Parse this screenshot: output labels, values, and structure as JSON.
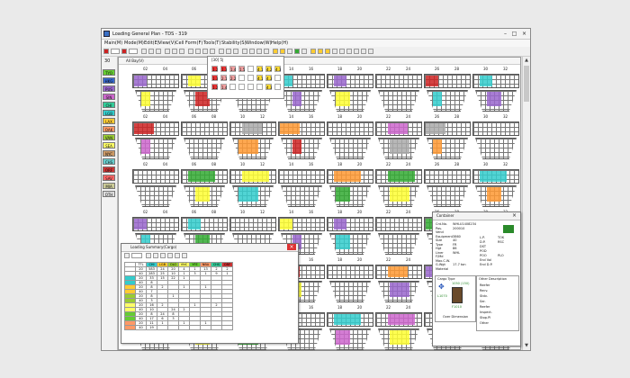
{
  "window": {
    "title": "Loading General Plan - TDS - 319"
  },
  "menu": [
    "Main(M)",
    "Mode(M)",
    "Edit(E)",
    "View(V)",
    "Cell Form(F)",
    "Tools(T)",
    "Stability(S)",
    "Window(W)",
    "Help(H)"
  ],
  "left_panel": {
    "counter": "30",
    "chips": [
      {
        "label": "TYO",
        "color": "#66cc33"
      },
      {
        "label": "HKG",
        "color": "#3366cc"
      },
      {
        "label": "PUS",
        "color": "#9966cc"
      },
      {
        "label": "SIN",
        "color": "#cc66cc"
      },
      {
        "label": "CHI",
        "color": "#33cc99"
      },
      {
        "label": "LGB",
        "color": "#33cccc"
      },
      {
        "label": "LAX",
        "color": "#ffcc33"
      },
      {
        "label": "OAK",
        "color": "#ff9966"
      },
      {
        "label": "VAN",
        "color": "#99cc33"
      },
      {
        "label": "SEA",
        "color": "#ffff66"
      },
      {
        "label": "NYC",
        "color": "#cc9966"
      },
      {
        "label": "CHS",
        "color": "#66cccc"
      },
      {
        "label": "ORF",
        "color": "#cc3333"
      },
      {
        "label": "SAV",
        "color": "#ff6666"
      },
      {
        "label": "MIA",
        "color": "#cccc99"
      },
      {
        "label": "OTH",
        "color": "#dddddd"
      }
    ]
  },
  "main_window": {
    "title": "All Bay(V)"
  },
  "popup": {
    "title": "[30] 5|",
    "cells": [
      "1.2",
      "1.3",
      "1.4",
      "1.5",
      "",
      "4.1",
      "4.2",
      "4.3",
      "1.3",
      "2.1",
      "2.2",
      "",
      "",
      "4.1",
      "4.3",
      "",
      "1.2",
      "1.4",
      "",
      "",
      "",
      "",
      "4.3",
      ""
    ]
  },
  "bays": [
    {
      "top": "02",
      "bot": "04"
    },
    {
      "top": "06",
      "bot": "08"
    },
    {
      "top": "10",
      "bot": "12"
    },
    {
      "top": "14",
      "bot": "16"
    },
    {
      "top": "18",
      "bot": "20"
    },
    {
      "top": "22",
      "bot": "24"
    },
    {
      "top": "26",
      "bot": "28"
    },
    {
      "top": "30",
      "bot": "32"
    }
  ],
  "row_labels": [
    "01",
    "03",
    "05",
    "07",
    "09",
    "11",
    "13",
    "15"
  ],
  "loading_summary": {
    "title": "Loading Summary(Cargo)",
    "headers": [
      "",
      "TTL",
      "CHI",
      "LGB",
      "OLO",
      "VNC",
      "YFE",
      "NBA",
      "CHS",
      "ORF"
    ],
    "header_colors": [
      "#ffffff",
      "#ffffff",
      "#33cccc",
      "#ffcc33",
      "#99cc33",
      "#ffff66",
      "#66cc33",
      "#ff9966",
      "#33cc99",
      "#cc3333"
    ],
    "rows": [
      [
        "20",
        "583",
        "24",
        "20",
        "4",
        "1",
        "13",
        "2",
        "2"
      ],
      [
        "40",
        "283",
        "25",
        "10",
        "1",
        "3",
        "1",
        "9",
        "1"
      ],
      [
        "20",
        "33",
        "15",
        "22",
        "1",
        "",
        "",
        "",
        ""
      ],
      [
        "40",
        "8",
        "",
        "",
        "",
        "",
        "",
        "",
        ""
      ],
      [
        "20",
        "8",
        "2",
        "",
        "1",
        "",
        "1",
        "",
        ""
      ],
      [
        "40",
        "7",
        "",
        "",
        "",
        "",
        "",
        "",
        ""
      ],
      [
        "20",
        "8",
        "",
        "1",
        "",
        "",
        "",
        "",
        ""
      ],
      [
        "40",
        "3",
        "",
        "",
        "",
        "",
        "",
        "",
        ""
      ],
      [
        "20",
        "16",
        "2",
        "",
        "",
        "1",
        "",
        "2",
        ""
      ],
      [
        "40",
        "10",
        "",
        "24",
        "2",
        "",
        "",
        "",
        ""
      ],
      [
        "20",
        "8",
        "24",
        "8",
        "",
        "",
        "",
        "",
        ""
      ],
      [
        "40",
        "17",
        "6",
        "3",
        "",
        "",
        "",
        "",
        ""
      ],
      [
        "20",
        "11",
        "1",
        "",
        "1",
        "",
        "1",
        "",
        ""
      ],
      [
        "40",
        "19",
        "",
        "",
        "",
        "",
        "",
        "",
        ""
      ]
    ]
  },
  "container": {
    "title": "Container",
    "fields": [
      {
        "k": "Cnt.No.",
        "v": "WHLU1408234"
      },
      {
        "k": "Pos.",
        "v": "200010"
      },
      {
        "k": "Vend",
        "v": ""
      },
      {
        "k": "Equipment",
        "v": "3860"
      },
      {
        "k": "Size",
        "v": "40"
      },
      {
        "k": "Type",
        "v": "FR"
      },
      {
        "k": "Hgt",
        "v": "86"
      },
      {
        "k": "Liner",
        "v": "WHL"
      },
      {
        "k": "F/Md",
        "v": ""
      },
      {
        "k": "Max.C.W.",
        "v": ""
      },
      {
        "k": "G.Wgt",
        "v": "17.7 ton"
      },
      {
        "k": "Material",
        "v": ""
      }
    ],
    "fields2": [
      {
        "k": "L.P.",
        "v": "TOK"
      },
      {
        "k": "D.P.",
        "v": "RSC"
      },
      {
        "k": "DST",
        "v": ""
      },
      {
        "k": "POD",
        "v": ""
      },
      {
        "k": "POO",
        "v": "PLO"
      },
      {
        "k": "End Vol",
        "v": ""
      },
      {
        "k": "End D.P.",
        "v": ""
      }
    ],
    "cargo_type": "Cargo Type",
    "other_desc": "Other Description",
    "other_items": [
      "Reefer",
      "Recv.",
      "Stdv.",
      "Ser.",
      "Reefer",
      "Inspect.",
      "Stop.Pl",
      "Other"
    ],
    "dims": [
      "1050 (150)",
      "1050 (150)",
      "L1070",
      "F1010"
    ],
    "over_dim": "Over Dimension"
  }
}
